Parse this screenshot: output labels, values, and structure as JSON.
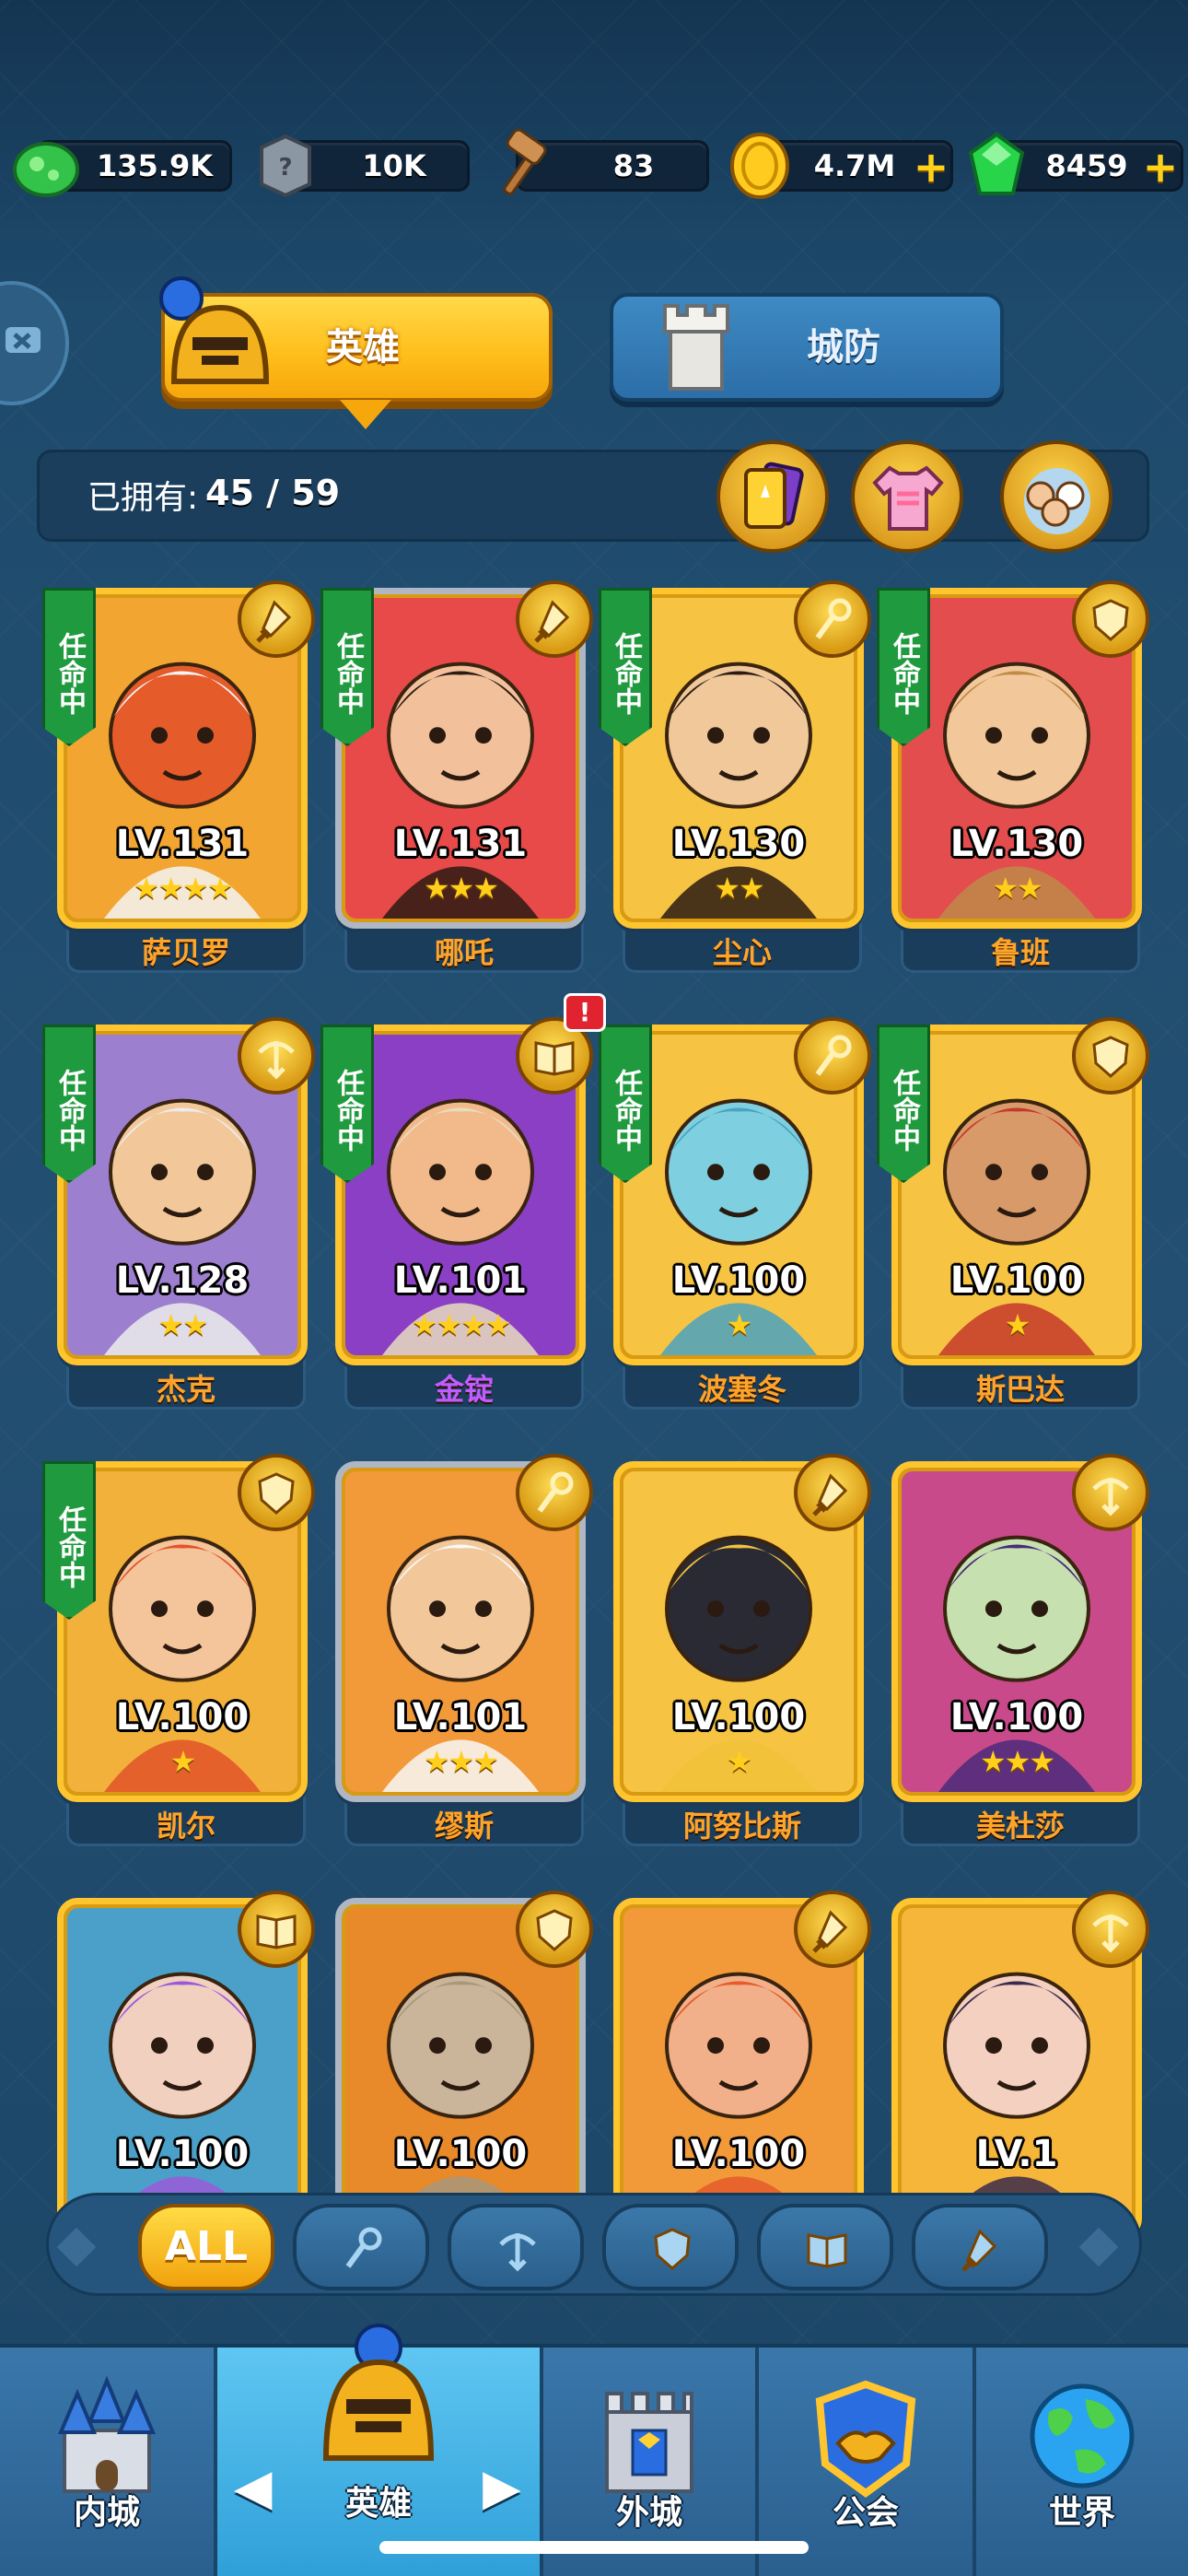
{
  "resources": {
    "elixir": "135.9K",
    "stone": "10K",
    "hammer": "83",
    "gold": "4.7M",
    "gems": "8459"
  },
  "tabs": {
    "heroes": "英雄",
    "defense": "城防"
  },
  "owned": {
    "label": "已拥有:",
    "value": "45 / 59"
  },
  "assign_label": "任命中",
  "alert_badge": "!",
  "heroes": [
    {
      "name": "萨贝罗",
      "level": "LV.131",
      "stars": "★★★★",
      "assigned": true,
      "cls": "sword-icon"
    },
    {
      "name": "哪吒",
      "level": "LV.131",
      "stars": "★★★",
      "assigned": true,
      "cls": "sword-icon"
    },
    {
      "name": "尘心",
      "level": "LV.130",
      "stars": "★★",
      "assigned": true,
      "cls": "staff-icon"
    },
    {
      "name": "鲁班",
      "level": "LV.130",
      "stars": "★★",
      "assigned": true,
      "cls": "shield-icon"
    },
    {
      "name": "杰克",
      "level": "LV.128",
      "stars": "★★",
      "assigned": true,
      "cls": "crossbow-icon"
    },
    {
      "name": "金锭",
      "level": "LV.101",
      "stars": "★★★★",
      "assigned": true,
      "cls": "book-icon"
    },
    {
      "name": "波塞冬",
      "level": "LV.100",
      "stars": "★",
      "assigned": true,
      "cls": "staff-icon"
    },
    {
      "name": "斯巴达",
      "level": "LV.100",
      "stars": "★",
      "assigned": true,
      "cls": "shield-icon"
    },
    {
      "name": "凯尔",
      "level": "LV.100",
      "stars": "★",
      "assigned": true,
      "cls": "shield-icon"
    },
    {
      "name": "缪斯",
      "level": "LV.101",
      "stars": "★★★",
      "assigned": false,
      "cls": "staff-icon"
    },
    {
      "name": "阿努比斯",
      "level": "LV.100",
      "stars": "★",
      "assigned": false,
      "cls": "sword-icon"
    },
    {
      "name": "美杜莎",
      "level": "LV.100",
      "stars": "★★★",
      "assigned": false,
      "cls": "crossbow-icon"
    },
    {
      "name": "",
      "level": "LV.100",
      "stars": "",
      "assigned": false,
      "cls": "book-icon"
    },
    {
      "name": "",
      "level": "LV.100",
      "stars": "",
      "assigned": false,
      "cls": "shield-icon"
    },
    {
      "name": "",
      "level": "LV.100",
      "stars": "",
      "assigned": false,
      "cls": "sword-icon"
    },
    {
      "name": "",
      "level": "LV.1",
      "stars": "",
      "assigned": false,
      "cls": "crossbow-icon"
    }
  ],
  "filters": {
    "all": "ALL",
    "items": [
      "staff-icon",
      "crossbow-icon",
      "shield-icon",
      "book-icon",
      "sword-icon"
    ]
  },
  "nav": {
    "inner_city": "内城",
    "heroes": "英雄",
    "outer_city": "外城",
    "guild": "公会",
    "world": "世界"
  }
}
